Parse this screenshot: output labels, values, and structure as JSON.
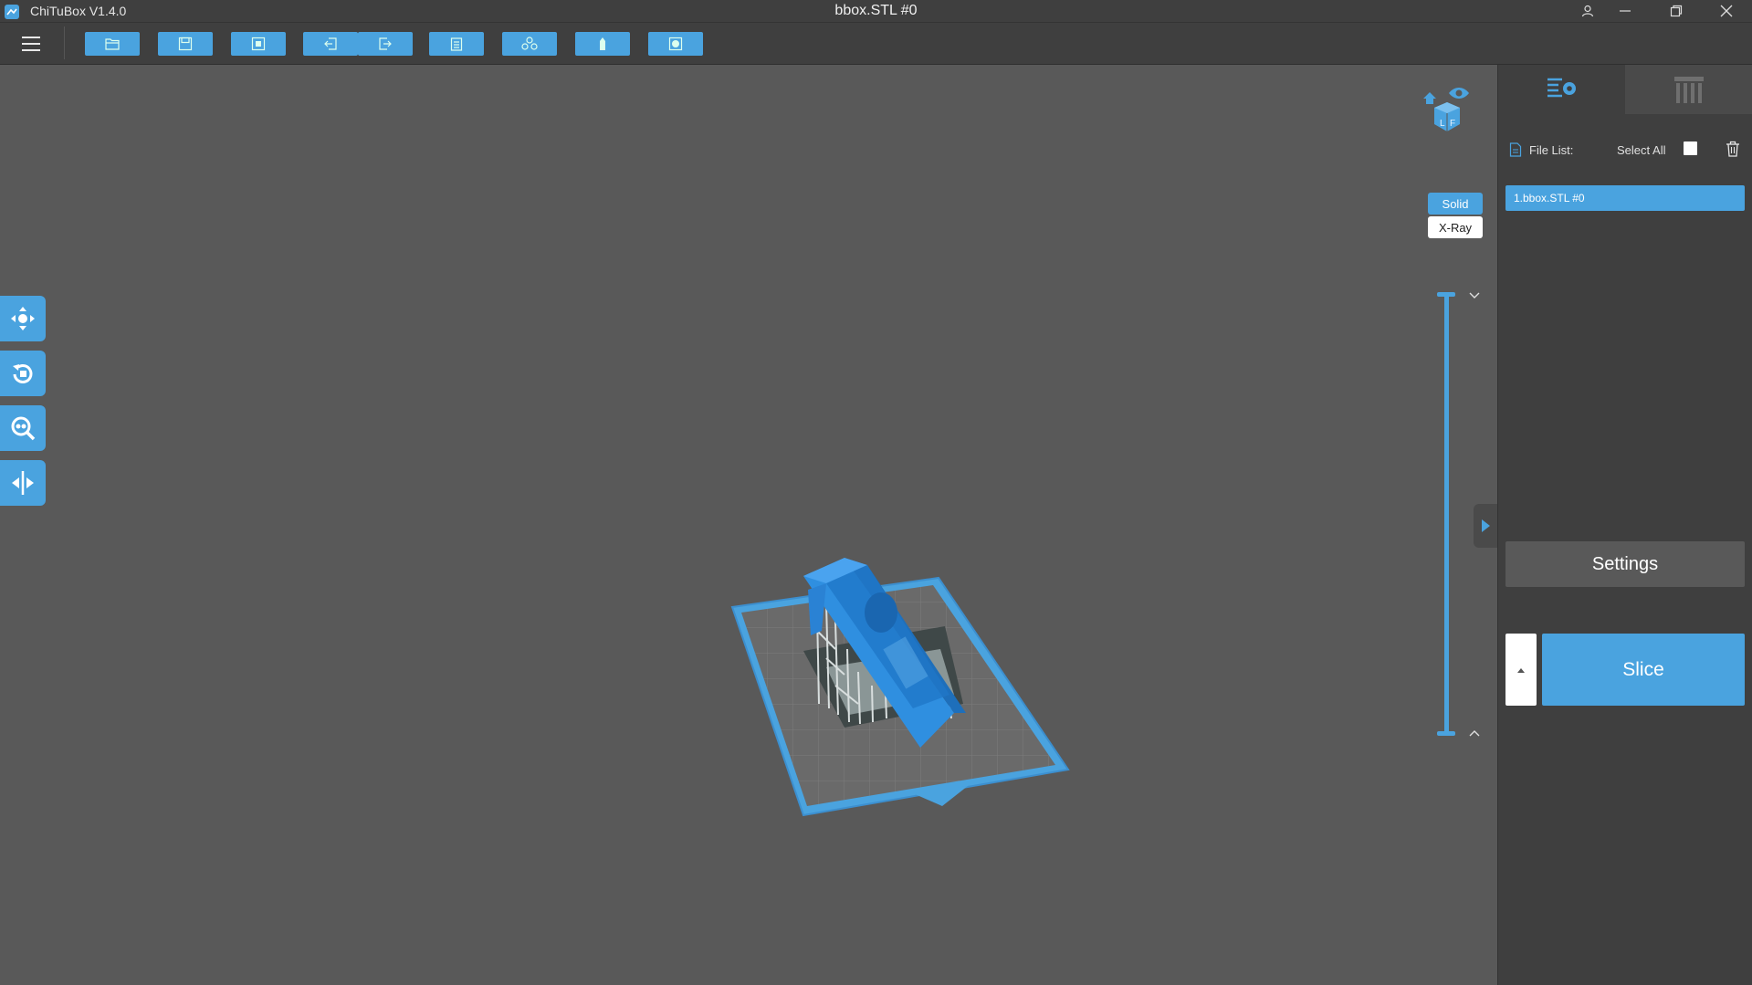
{
  "app": {
    "name": "ChiTuBox V1.4.0",
    "window_title": "bbox.STL #0"
  },
  "toolbar": {
    "buttons": [
      {
        "icon": "open-file-icon"
      },
      {
        "icon": "save-icon"
      },
      {
        "icon": "screenshot-icon"
      },
      {
        "icon": "import-icon"
      },
      {
        "icon": "export-icon"
      },
      {
        "icon": "clipboard-icon"
      },
      {
        "icon": "arrange-icon"
      },
      {
        "icon": "hollow-icon"
      },
      {
        "icon": "fill-icon"
      }
    ]
  },
  "left_tools": [
    {
      "icon": "move-icon"
    },
    {
      "icon": "rotate-icon"
    },
    {
      "icon": "scale-icon"
    },
    {
      "icon": "mirror-icon"
    }
  ],
  "view": {
    "modes": [
      "Solid",
      "X-Ray"
    ],
    "active_mode": "Solid"
  },
  "right_panel": {
    "tabs": [
      {
        "icon": "file-settings-icon",
        "active": true
      },
      {
        "icon": "supports-icon",
        "active": false
      }
    ],
    "file_list_label": "File List:",
    "select_all_label": "Select All",
    "files": [
      "1.bbox.STL #0"
    ],
    "settings_label": "Settings",
    "slice_label": "Slice"
  },
  "colors": {
    "accent": "#4aa3df",
    "viewport_bg": "#595959",
    "panel_bg": "#3f3f3f",
    "model": "#2f8fe0"
  }
}
